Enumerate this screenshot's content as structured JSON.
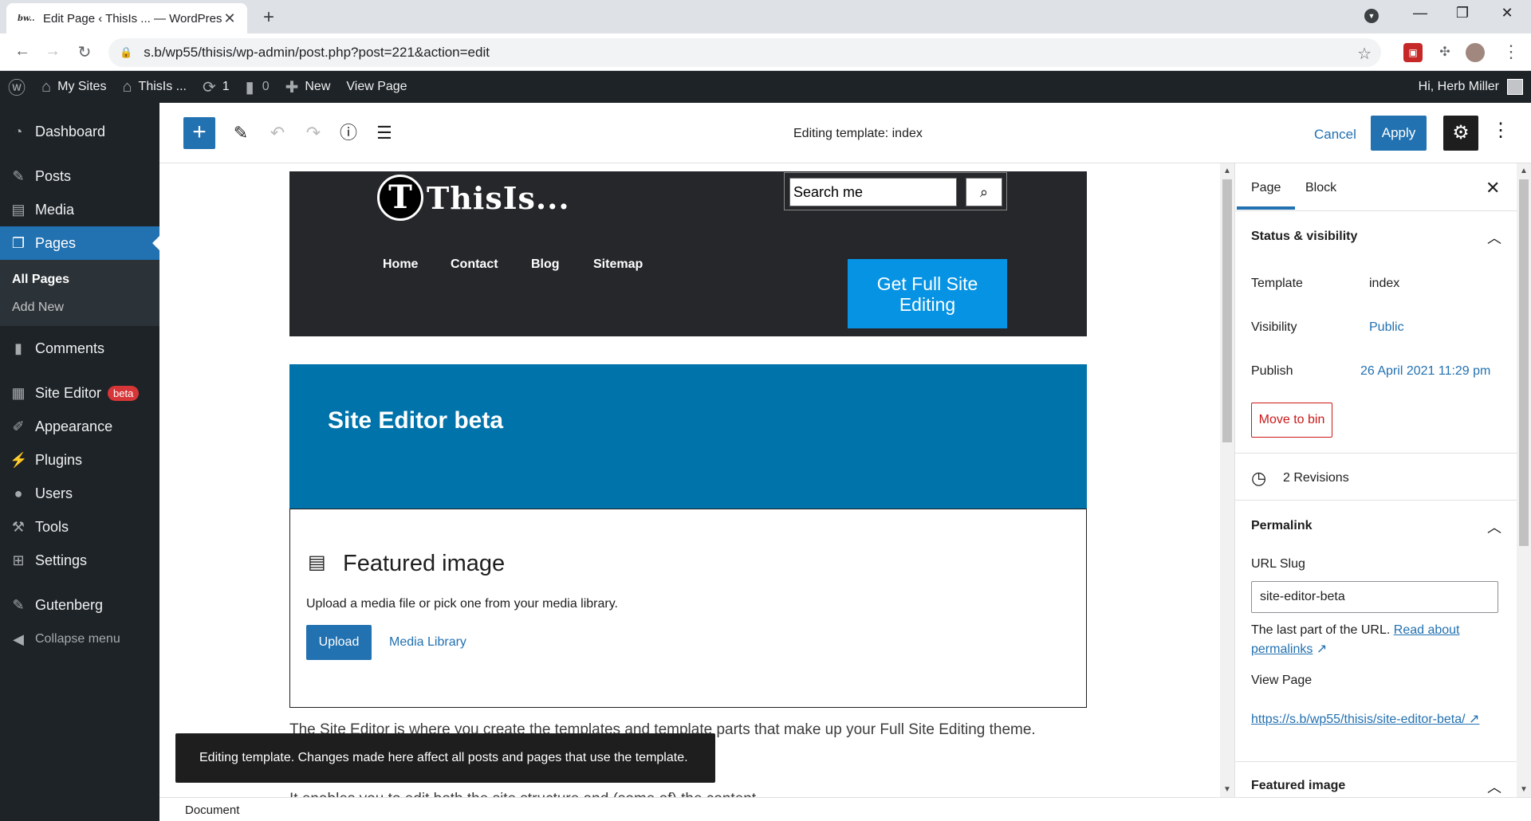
{
  "browser": {
    "tab_title": "Edit Page ‹ ThisIs ... — WordPress",
    "tab_favicon": "bw..",
    "url": "s.b/wp55/thisis/wp-admin/post.php?post=221&action=edit"
  },
  "adminbar": {
    "my_sites": "My Sites",
    "site_name": "ThisIs ...",
    "updates_count": "1",
    "comments_count": "0",
    "new_label": "New",
    "view_page": "View Page",
    "greeting": "Hi, Herb Miller"
  },
  "sidebar": {
    "items": [
      {
        "label": "Dashboard",
        "icon": "dashboard-icon"
      },
      {
        "label": "Posts",
        "icon": "pin-icon"
      },
      {
        "label": "Media",
        "icon": "media-icon"
      },
      {
        "label": "Pages",
        "icon": "pages-icon"
      },
      {
        "label": "Comments",
        "icon": "comment-icon"
      },
      {
        "label": "Site Editor",
        "icon": "layout-icon",
        "badge": "beta"
      },
      {
        "label": "Appearance",
        "icon": "brush-icon"
      },
      {
        "label": "Plugins",
        "icon": "plug-icon"
      },
      {
        "label": "Users",
        "icon": "user-icon"
      },
      {
        "label": "Tools",
        "icon": "wrench-icon"
      },
      {
        "label": "Settings",
        "icon": "settings-icon"
      },
      {
        "label": "Gutenberg",
        "icon": "pencil-icon"
      }
    ],
    "submenu": [
      "All Pages",
      "Add New"
    ],
    "collapse": "Collapse menu"
  },
  "editor": {
    "title": "Editing template: index",
    "cancel": "Cancel",
    "apply": "Apply"
  },
  "canvas": {
    "logo_letter": "T",
    "logo_text": "ThisIs...",
    "search_placeholder": "Search me",
    "nav": [
      "Home",
      "Contact",
      "Blog",
      "Sitemap"
    ],
    "fse_button": "Get Full Site Editing",
    "cover_title": "Site Editor beta",
    "featured_title": "Featured image",
    "featured_instructions": "Upload a media file or pick one from your media library.",
    "upload": "Upload",
    "media_library": "Media Library",
    "para1": "The Site Editor is where you create the templates and template parts that make up your Full Site Editing theme.",
    "para2": "It enables you to edit both the site structure and (some of) the content.",
    "snackbar": "Editing template. Changes made here affect all posts and pages that use the template.",
    "breadcrumb": "Document"
  },
  "settings": {
    "tab_page": "Page",
    "tab_block": "Block",
    "status_heading": "Status & visibility",
    "template_label": "Template",
    "template_value": "index",
    "visibility_label": "Visibility",
    "visibility_value": "Public",
    "publish_label": "Publish",
    "publish_value": "26 April 2021 11:29 pm",
    "move_to_bin": "Move to bin",
    "revisions": "2 Revisions",
    "permalink_heading": "Permalink",
    "url_slug_label": "URL Slug",
    "url_slug_value": "site-editor-beta",
    "help_prefix": "The last part of the URL.",
    "help_link": "Read about permalinks",
    "view_page_label": "View Page",
    "permalink_url": "https://s.b/wp55/thisis/site-editor-beta/",
    "featured_heading": "Featured image"
  },
  "colors": {
    "wp_blue": "#2271b1",
    "admin_dark": "#1d2327",
    "cover_blue": "#0073aa",
    "fse_blue": "#0693e3",
    "danger": "#cc1818"
  }
}
